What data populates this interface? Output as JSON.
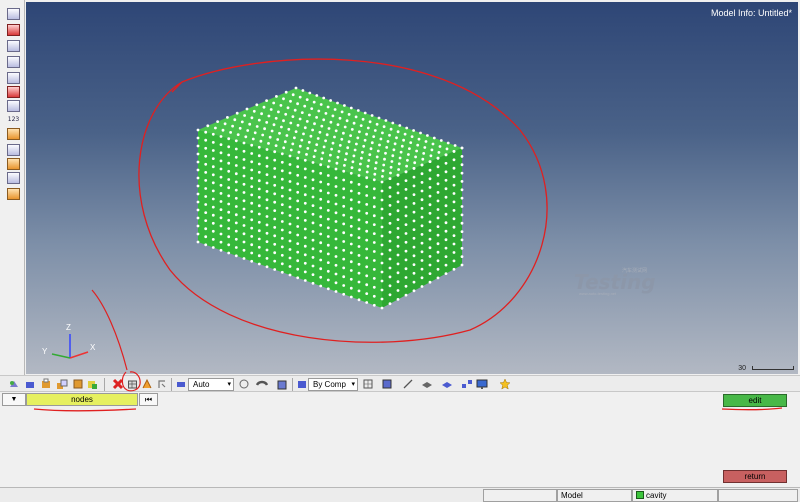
{
  "viewport": {
    "model_info": "Model Info: Untitled*",
    "scale_value": "30",
    "watermark_small": "汽车测试网",
    "watermark_main": "Testing",
    "watermark_url": "www.auto-testing.net",
    "axis_labels": {
      "z": "Z",
      "y": "Y",
      "x": "X"
    }
  },
  "mesh": {
    "color": "#36b83a",
    "node_color": "#ffffff"
  },
  "left_toolbar": {
    "icons": [
      "display-icon",
      "toggle-icon",
      "mask-icon",
      "find-icon",
      "component-icon",
      "reverse-icon",
      "ring-icon",
      "numbers-icon",
      "measure-icon",
      "text-icon",
      "text-icon",
      "select-icon",
      "highlight-icon"
    ],
    "label_123": "123"
  },
  "bottom_toolbar": {
    "auto_select": "Auto",
    "color_mode": "By Comp"
  },
  "panel": {
    "entity_selector": "nodes",
    "edit_label": "edit",
    "return_label": "return"
  },
  "status_bar": {
    "model_label": "Model",
    "component_label": "cavity"
  },
  "colors": {
    "edit": "#48b848",
    "return": "#c86060",
    "selector": "#e6f060",
    "annotation": "#e02020"
  }
}
